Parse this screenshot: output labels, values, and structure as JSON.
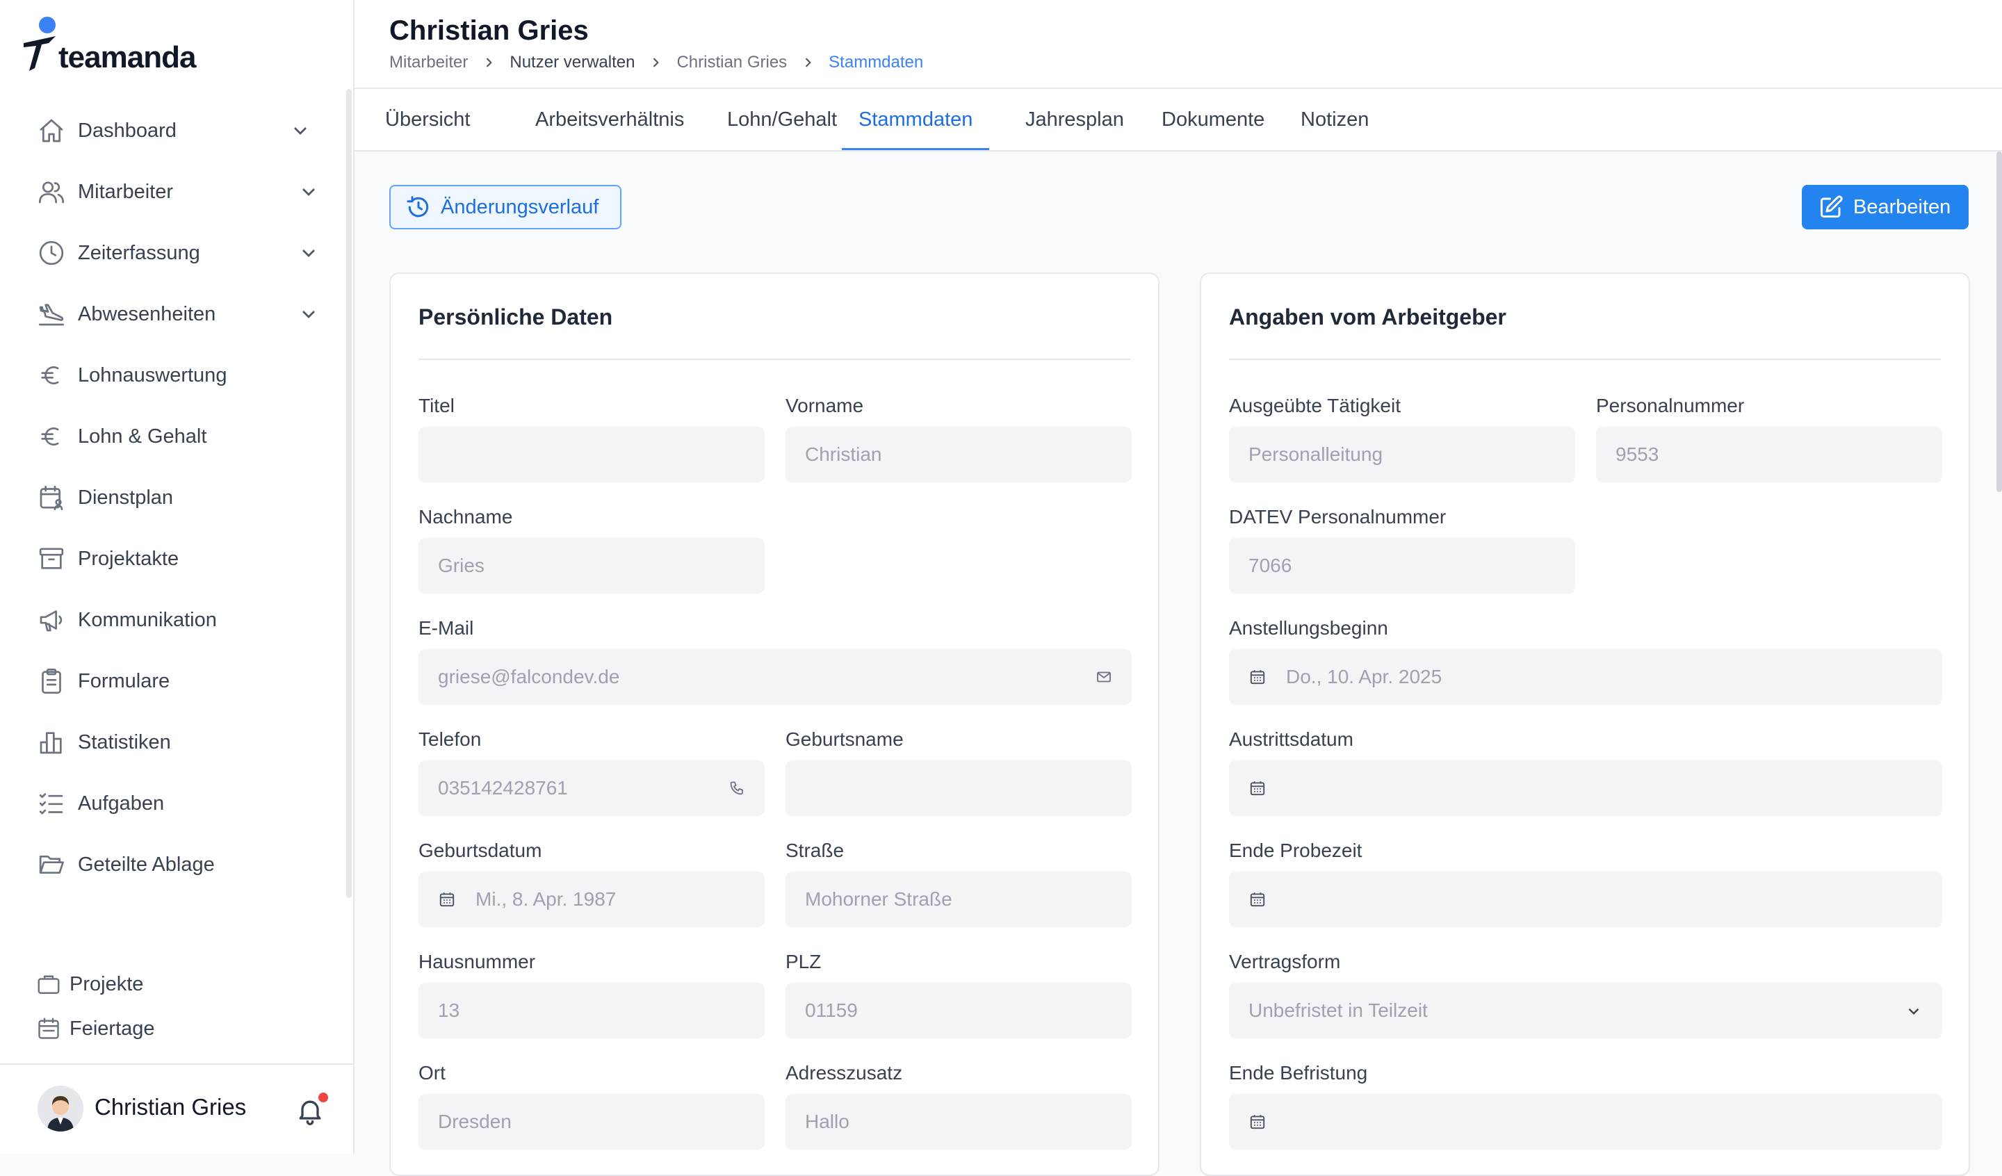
{
  "app": {
    "name": "teamanda"
  },
  "sidebar": {
    "items": [
      {
        "label": "Dashboard",
        "icon": "home-icon"
      },
      {
        "label": "Mitarbeiter",
        "icon": "users-icon"
      },
      {
        "label": "Zeiterfassung",
        "icon": "clock-icon"
      },
      {
        "label": "Abwesenheiten",
        "icon": "plane-icon"
      },
      {
        "label": "Lohnauswertung",
        "icon": "euro-icon"
      },
      {
        "label": "Lohn & Gehalt",
        "icon": "euro-icon"
      },
      {
        "label": "Dienstplan",
        "icon": "calendar-user-icon"
      },
      {
        "label": "Projektakte",
        "icon": "archive-icon"
      },
      {
        "label": "Kommunikation",
        "icon": "megaphone-icon"
      },
      {
        "label": "Formulare",
        "icon": "clipboard-icon"
      },
      {
        "label": "Statistiken",
        "icon": "bar-chart-icon"
      },
      {
        "label": "Aufgaben",
        "icon": "list-check-icon"
      },
      {
        "label": "Geteilte Ablage",
        "icon": "folder-open-icon"
      }
    ],
    "bottom_items": [
      {
        "label": "Projekte",
        "icon": "briefcase-icon"
      },
      {
        "label": "Feiertage",
        "icon": "calendar-icon"
      }
    ],
    "user": {
      "name": "Christian Gries",
      "has_notification": true
    }
  },
  "header": {
    "title": "Christian Gries",
    "breadcrumb": [
      "Mitarbeiter",
      "Nutzer verwalten",
      "Christian Gries",
      "Stammdaten"
    ]
  },
  "tabs": [
    "Übersicht",
    "Arbeitsverhältnis",
    "Lohn/Gehalt",
    "Stammdaten",
    "Jahresplan",
    "Dokumente",
    "Notizen"
  ],
  "active_tab": "Stammdaten",
  "actions": {
    "history": "Änderungsverlauf",
    "edit": "Bearbeiten"
  },
  "personal": {
    "title": "Persönliche Daten",
    "fields": {
      "titel": {
        "label": "Titel",
        "value": ""
      },
      "vorname": {
        "label": "Vorname",
        "value": "Christian"
      },
      "nachname": {
        "label": "Nachname",
        "value": "Gries"
      },
      "email": {
        "label": "E-Mail",
        "value": "griese@falcondev.de"
      },
      "telefon": {
        "label": "Telefon",
        "value": "035142428761"
      },
      "geburtsname": {
        "label": "Geburtsname",
        "value": ""
      },
      "geburtsdatum": {
        "label": "Geburtsdatum",
        "value": "Mi., 8. Apr. 1987"
      },
      "strasse": {
        "label": "Straße",
        "value": "Mohorner Straße"
      },
      "hausnummer": {
        "label": "Hausnummer",
        "value": "13"
      },
      "plz": {
        "label": "PLZ",
        "value": "01159"
      },
      "ort": {
        "label": "Ort",
        "value": "Dresden"
      },
      "adresszusatz": {
        "label": "Adresszusatz",
        "value": "Hallo"
      }
    }
  },
  "employer": {
    "title": "Angaben vom Arbeitgeber",
    "fields": {
      "taetigkeit": {
        "label": "Ausgeübte Tätigkeit",
        "value": "Personalleitung"
      },
      "personalnummer": {
        "label": "Personalnummer",
        "value": "9553"
      },
      "datev": {
        "label": "DATEV Personalnummer",
        "value": "7066"
      },
      "anstellungsbeginn": {
        "label": "Anstellungsbeginn",
        "value": "Do., 10. Apr. 2025"
      },
      "austrittsdatum": {
        "label": "Austrittsdatum",
        "value": ""
      },
      "probezeit": {
        "label": "Ende Probezeit",
        "value": ""
      },
      "vertragsform": {
        "label": "Vertragsform",
        "value": "Unbefristet in Teilzeit"
      },
      "befristung": {
        "label": "Ende Befristung",
        "value": ""
      }
    }
  },
  "colors": {
    "accent": "#2383ef",
    "active_tab": "#3b82f6",
    "field_bg": "#f3f4f6",
    "notification": "#ef4444"
  }
}
